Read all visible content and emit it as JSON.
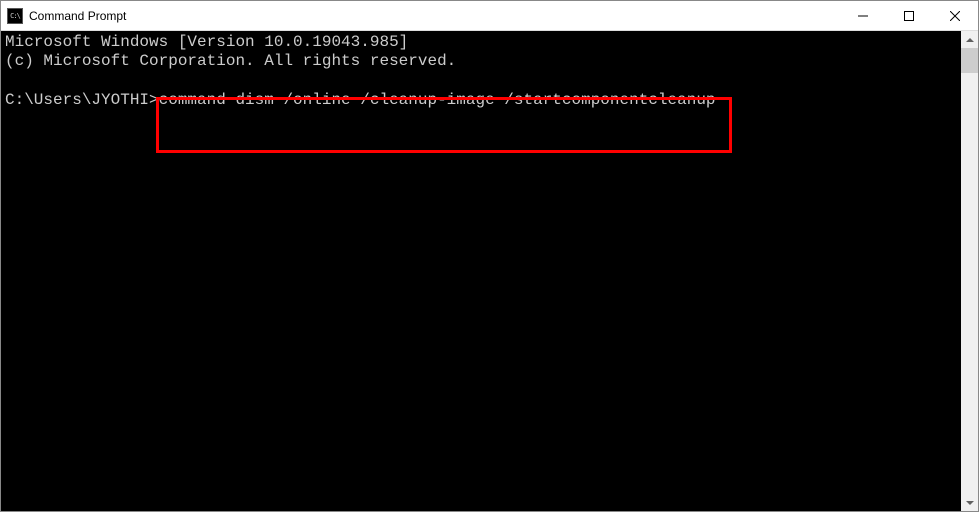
{
  "window": {
    "title": "Command Prompt"
  },
  "terminal": {
    "line1": "Microsoft Windows [Version 10.0.19043.985]",
    "line2": "(c) Microsoft Corporation. All rights reserved.",
    "prompt": "C:\\Users\\JYOTHI>",
    "command": "command dism /online /cleanup-image /startcomponentcleanup"
  }
}
